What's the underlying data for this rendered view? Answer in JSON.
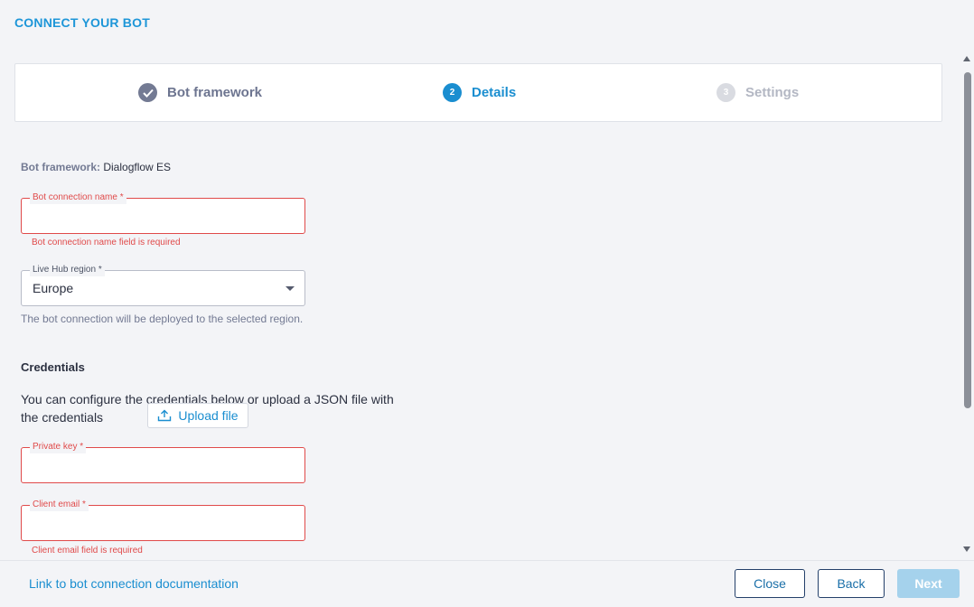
{
  "header": {
    "title": "CONNECT YOUR BOT"
  },
  "stepper": {
    "steps": [
      {
        "number": "",
        "label": "Bot framework",
        "state": "completed",
        "icon": "check-icon"
      },
      {
        "number": "2",
        "label": "Details",
        "state": "active"
      },
      {
        "number": "3",
        "label": "Settings",
        "state": "upcoming"
      }
    ]
  },
  "form": {
    "framework_key": "Bot framework:",
    "framework_value": " Dialogflow ES",
    "connection_name": {
      "label": "Bot connection name *",
      "value": "",
      "error": "Bot connection name field is required"
    },
    "region": {
      "label": "Live Hub region *",
      "value": "Europe",
      "hint": "The bot connection will be deployed to the selected region."
    },
    "credentials": {
      "heading": "Credentials",
      "description": "You can configure the credentials below or upload a JSON file with the credentials",
      "upload_label": "Upload file",
      "private_key": {
        "label": "Private key *",
        "value": ""
      },
      "client_email": {
        "label": "Client email *",
        "value": "",
        "error": "Client email field is required"
      }
    }
  },
  "footer": {
    "doc_link": "Link to bot connection documentation",
    "close_label": "Close",
    "back_label": "Back",
    "next_label": "Next"
  },
  "colors": {
    "accent": "#1a8ed0",
    "error": "#e04a4a",
    "muted": "#737a93"
  }
}
